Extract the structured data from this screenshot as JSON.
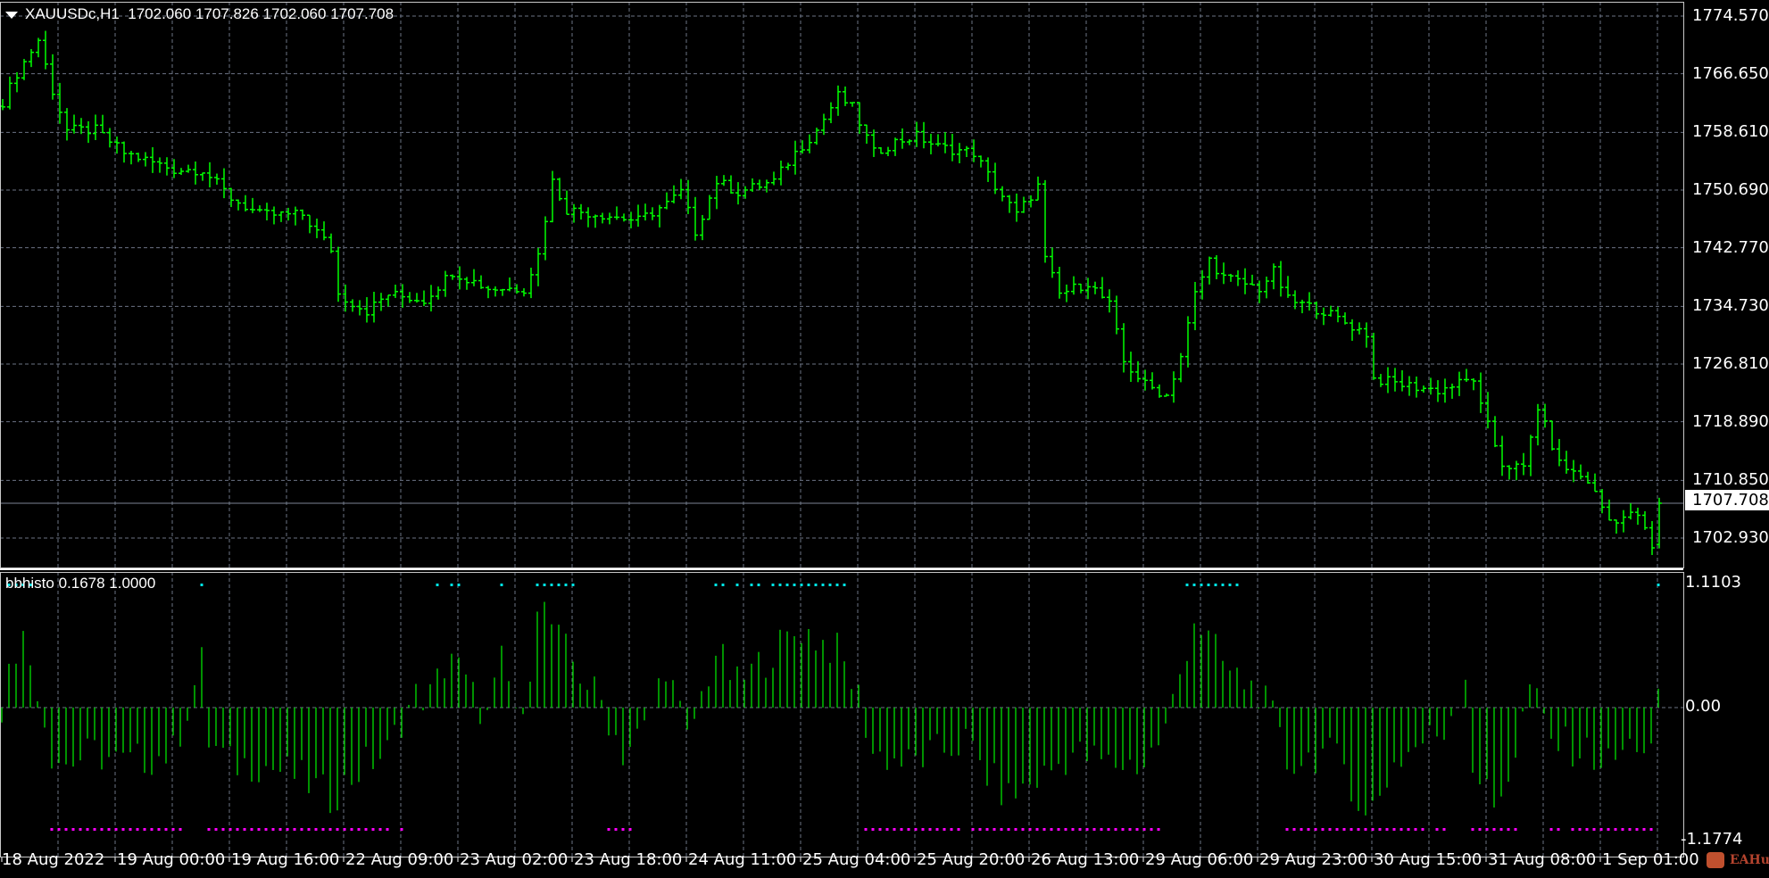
{
  "header": {
    "symbol": "XAUUSDc,H1",
    "open": "1702.060",
    "high": "1707.826",
    "low": "1702.060",
    "close": "1707.708"
  },
  "price_axis": [
    "1774.570",
    "1766.650",
    "1758.610",
    "1750.690",
    "1742.770",
    "1734.730",
    "1726.810",
    "1718.890",
    "1710.850",
    "1702.930"
  ],
  "current_price": "1707.708",
  "indicator": {
    "name": "bbhisto",
    "value1": "0.1678",
    "value2": "1.0000",
    "axis": [
      "1.1103",
      "0.00",
      "-1.1774"
    ]
  },
  "time_axis": [
    "18 Aug 2022",
    "19 Aug 00:00",
    "19 Aug 16:00",
    "22 Aug 09:00",
    "23 Aug 02:00",
    "23 Aug 18:00",
    "24 Aug 11:00",
    "25 Aug 04:00",
    "25 Aug 20:00",
    "26 Aug 13:00",
    "29 Aug 06:00",
    "29 Aug 23:00",
    "30 Aug 15:00",
    "31 Aug 08:00",
    "1 Sep 01:00"
  ],
  "logo": "EAHub",
  "colors": {
    "bars": "#00ff00",
    "histogram": "#00e000",
    "up_dots": "#00e5e5",
    "down_dots": "#ff00ff",
    "grid": "#8a94a6",
    "background": "#000000"
  },
  "chart_data": {
    "type": "bar",
    "title": "XAUUSDc,H1",
    "bar_count": 233,
    "ylim": [
      1699.5,
      1776.5
    ],
    "close_keypoints_bar_price": [
      [
        0,
        1762.8
      ],
      [
        2,
        1766.7
      ],
      [
        5,
        1771.3
      ],
      [
        7,
        1764.3
      ],
      [
        9,
        1758.9
      ],
      [
        13,
        1758.9
      ],
      [
        17,
        1755.8
      ],
      [
        24,
        1753.5
      ],
      [
        28,
        1753.5
      ],
      [
        32,
        1749.6
      ],
      [
        36,
        1747.3
      ],
      [
        42,
        1747.3
      ],
      [
        46,
        1742.6
      ],
      [
        47,
        1736.4
      ],
      [
        51,
        1734.1
      ],
      [
        54,
        1736.4
      ],
      [
        59,
        1735.6
      ],
      [
        63,
        1739.5
      ],
      [
        68,
        1737.2
      ],
      [
        73,
        1737.2
      ],
      [
        75,
        1741.8
      ],
      [
        77,
        1751.9
      ],
      [
        79,
        1748.0
      ],
      [
        84,
        1747.3
      ],
      [
        89,
        1746.5
      ],
      [
        93,
        1748.8
      ],
      [
        95,
        1750.4
      ],
      [
        97,
        1745.0
      ],
      [
        100,
        1751.9
      ],
      [
        103,
        1750.4
      ],
      [
        108,
        1751.9
      ],
      [
        111,
        1755.8
      ],
      [
        114,
        1758.9
      ],
      [
        117,
        1763.6
      ],
      [
        119,
        1762.0
      ],
      [
        122,
        1755.8
      ],
      [
        125,
        1757.3
      ],
      [
        128,
        1758.1
      ],
      [
        131,
        1756.6
      ],
      [
        136,
        1755.8
      ],
      [
        139,
        1751.2
      ],
      [
        142,
        1747.3
      ],
      [
        145,
        1751.2
      ],
      [
        146,
        1741.1
      ],
      [
        148,
        1736.4
      ],
      [
        152,
        1738.0
      ],
      [
        155,
        1734.9
      ],
      [
        157,
        1727.1
      ],
      [
        160,
        1724.0
      ],
      [
        163,
        1722.5
      ],
      [
        165,
        1727.9
      ],
      [
        167,
        1736.4
      ],
      [
        169,
        1741.1
      ],
      [
        171,
        1738.7
      ],
      [
        176,
        1737.2
      ],
      [
        178,
        1739.5
      ],
      [
        180,
        1735.6
      ],
      [
        185,
        1734.1
      ],
      [
        188,
        1732.5
      ],
      [
        191,
        1731.0
      ],
      [
        192,
        1724.8
      ],
      [
        196,
        1724.0
      ],
      [
        201,
        1723.2
      ],
      [
        206,
        1724.8
      ],
      [
        207,
        1720.9
      ],
      [
        210,
        1713.1
      ],
      [
        213,
        1712.4
      ],
      [
        215,
        1720.9
      ],
      [
        218,
        1713.1
      ],
      [
        222,
        1710.8
      ],
      [
        225,
        1705.4
      ],
      [
        229,
        1706.2
      ],
      [
        231,
        1701.5
      ],
      [
        232,
        1707.7
      ]
    ],
    "histogram": {
      "name": "bbhisto",
      "ylim": [
        -1.1774,
        1.1103
      ],
      "keypoints_bar_value": [
        [
          0,
          -0.2
        ],
        [
          1,
          0.5
        ],
        [
          3,
          0.6
        ],
        [
          5,
          0.2
        ],
        [
          7,
          -0.4
        ],
        [
          9,
          -0.5
        ],
        [
          13,
          -0.4
        ],
        [
          17,
          -0.5
        ],
        [
          24,
          -0.4
        ],
        [
          28,
          0.4
        ],
        [
          29,
          -0.3
        ],
        [
          32,
          -0.5
        ],
        [
          36,
          -0.5
        ],
        [
          41,
          -0.6
        ],
        [
          46,
          -0.8
        ],
        [
          51,
          -0.5
        ],
        [
          54,
          -0.4
        ],
        [
          56,
          -0.1
        ],
        [
          58,
          0.1
        ],
        [
          60,
          0.1
        ],
        [
          63,
          0.5
        ],
        [
          65,
          0.2
        ],
        [
          68,
          -0.1
        ],
        [
          70,
          0.4
        ],
        [
          73,
          -0.2
        ],
        [
          75,
          1.0
        ],
        [
          78,
          0.6
        ],
        [
          81,
          0.3
        ],
        [
          84,
          0.05
        ],
        [
          87,
          -0.4
        ],
        [
          90,
          -0.2
        ],
        [
          93,
          0.4
        ],
        [
          96,
          -0.3
        ],
        [
          100,
          0.5
        ],
        [
          103,
          0.2
        ],
        [
          108,
          0.5
        ],
        [
          112,
          0.7
        ],
        [
          117,
          0.5
        ],
        [
          120,
          0.1
        ],
        [
          122,
          -0.4
        ],
        [
          127,
          -0.5
        ],
        [
          131,
          -0.4
        ],
        [
          135,
          -0.3
        ],
        [
          138,
          -0.6
        ],
        [
          141,
          -0.8
        ],
        [
          146,
          -0.6
        ],
        [
          150,
          -0.4
        ],
        [
          155,
          -0.5
        ],
        [
          160,
          -0.5
        ],
        [
          163,
          -0.2
        ],
        [
          165,
          0.3
        ],
        [
          167,
          0.8
        ],
        [
          169,
          0.6
        ],
        [
          172,
          0.3
        ],
        [
          176,
          0.15
        ],
        [
          178,
          -0.1
        ],
        [
          180,
          -0.5
        ],
        [
          185,
          -0.4
        ],
        [
          188,
          -0.5
        ],
        [
          191,
          -1.0
        ],
        [
          195,
          -0.5
        ],
        [
          199,
          -0.3
        ],
        [
          202,
          -0.2
        ],
        [
          205,
          0.3
        ],
        [
          206,
          -0.5
        ],
        [
          209,
          -0.9
        ],
        [
          212,
          -0.4
        ],
        [
          214,
          0.2
        ],
        [
          217,
          -0.3
        ],
        [
          222,
          -0.4
        ],
        [
          225,
          -0.5
        ],
        [
          229,
          -0.3
        ],
        [
          231,
          -0.4
        ],
        [
          232,
          0.17
        ]
      ]
    }
  }
}
